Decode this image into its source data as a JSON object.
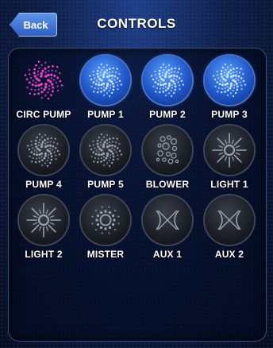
{
  "header": {
    "back_label": "Back",
    "title": "CONTROLS"
  },
  "controls": [
    {
      "label": "CIRC PUMP",
      "icon": "circ-pump-icon",
      "state": "active-pink"
    },
    {
      "label": "PUMP 1",
      "icon": "pump-icon",
      "state": "on"
    },
    {
      "label": "PUMP 2",
      "icon": "pump-icon",
      "state": "on"
    },
    {
      "label": "PUMP 3",
      "icon": "pump-icon",
      "state": "on"
    },
    {
      "label": "PUMP 4",
      "icon": "pump-icon",
      "state": "off"
    },
    {
      "label": "PUMP 5",
      "icon": "pump-icon",
      "state": "off"
    },
    {
      "label": "BLOWER",
      "icon": "blower-icon",
      "state": "off"
    },
    {
      "label": "LIGHT 1",
      "icon": "light-icon",
      "state": "off"
    },
    {
      "label": "LIGHT 2",
      "icon": "light-icon",
      "state": "off"
    },
    {
      "label": "MISTER",
      "icon": "mister-icon",
      "state": "off"
    },
    {
      "label": "AUX 1",
      "icon": "aux-icon",
      "state": "off"
    },
    {
      "label": "AUX 2",
      "icon": "aux-icon",
      "state": "off"
    }
  ],
  "colors": {
    "accent_blue": "#2e5fc2",
    "active_pink": "#e040c8",
    "on_dots": "#cfe6ff",
    "off_dots": "#9aa0ad"
  }
}
